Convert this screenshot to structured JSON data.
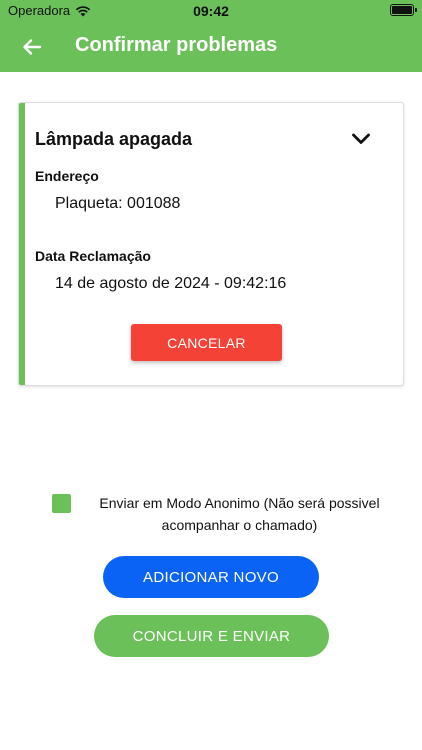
{
  "status_bar": {
    "carrier": "Operadora",
    "time": "09:42",
    "icons": [
      "wifi-icon",
      "battery-icon"
    ]
  },
  "app_bar": {
    "title": "Confirmar problemas",
    "back_icon": "arrow-left-icon"
  },
  "problem_card": {
    "title": "Lâmpada apagada",
    "expand_icon": "chevron-down-icon",
    "address_label": "Endereço",
    "address_value": "Plaqueta: 001088",
    "date_label": "Data Reclamação",
    "date_value": "14 de agosto de 2024 - 09:42:16",
    "cancel_label": "CANCELAR"
  },
  "anonymous": {
    "checked": true,
    "label": "Enviar em Modo Anonimo (Não será possivel acompanhar o chamado)"
  },
  "actions": {
    "add_label": "ADICIONAR NOVO",
    "submit_label": "CONCLUIR E ENVIAR"
  },
  "colors": {
    "primary": "#6cc05a",
    "cancel": "#f44236",
    "add": "#0b63f6"
  }
}
